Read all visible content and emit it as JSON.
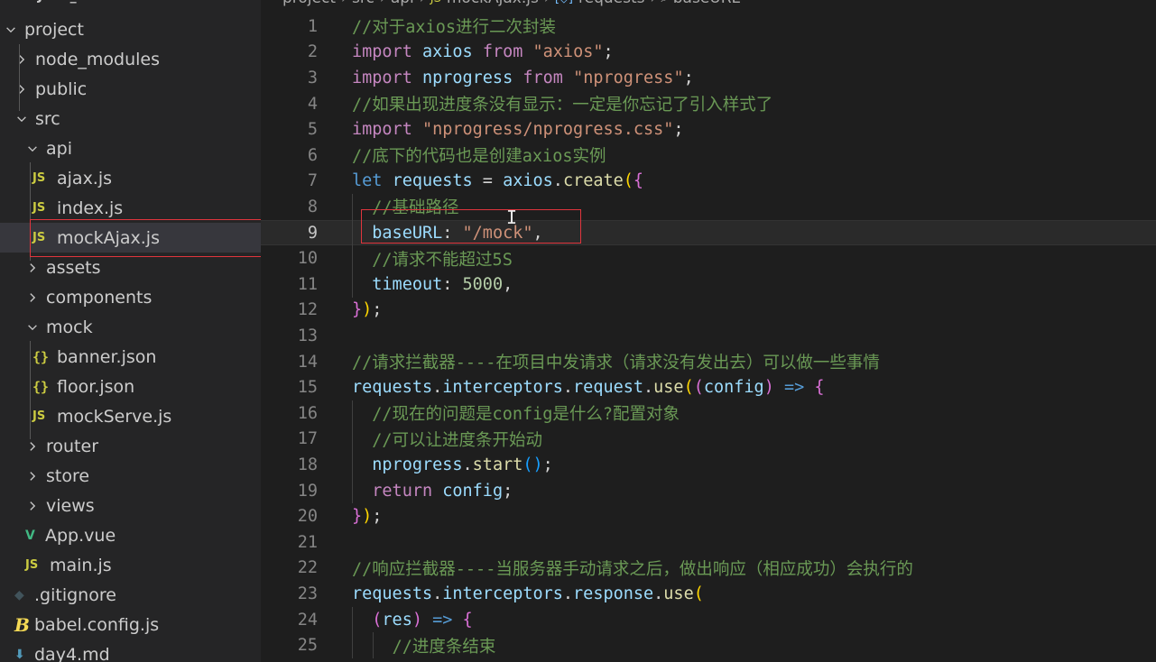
{
  "explorer": {
    "header": "PROJECT_SHP",
    "items": [
      {
        "label": "project",
        "kind": "folder",
        "open": true,
        "depth": 0,
        "icon": "chevron-down-icon"
      },
      {
        "label": "node_modules",
        "kind": "folder",
        "open": false,
        "depth": 1,
        "icon": "chevron-right-icon"
      },
      {
        "label": "public",
        "kind": "folder",
        "open": false,
        "depth": 1,
        "icon": "chevron-right-icon"
      },
      {
        "label": "src",
        "kind": "folder",
        "open": true,
        "depth": 1,
        "icon": "chevron-down-icon"
      },
      {
        "label": "api",
        "kind": "folder",
        "open": true,
        "depth": 2,
        "icon": "chevron-down-icon"
      },
      {
        "label": "ajax.js",
        "kind": "js",
        "depth": 3,
        "icon": "js-file-icon",
        "badge": "JS"
      },
      {
        "label": "index.js",
        "kind": "js",
        "depth": 3,
        "icon": "js-file-icon",
        "badge": "JS"
      },
      {
        "label": "mockAjax.js",
        "kind": "js",
        "depth": 3,
        "icon": "js-file-icon",
        "badge": "JS",
        "selected": true
      },
      {
        "label": "assets",
        "kind": "folder",
        "open": false,
        "depth": 2,
        "icon": "chevron-right-icon"
      },
      {
        "label": "components",
        "kind": "folder",
        "open": false,
        "depth": 2,
        "icon": "chevron-right-icon"
      },
      {
        "label": "mock",
        "kind": "folder",
        "open": true,
        "depth": 2,
        "icon": "chevron-down-icon"
      },
      {
        "label": "banner.json",
        "kind": "json",
        "depth": 3,
        "icon": "json-file-icon",
        "badge": "{}"
      },
      {
        "label": "floor.json",
        "kind": "json",
        "depth": 3,
        "icon": "json-file-icon",
        "badge": "{}"
      },
      {
        "label": "mockServe.js",
        "kind": "js",
        "depth": 3,
        "icon": "js-file-icon",
        "badge": "JS"
      },
      {
        "label": "router",
        "kind": "folder",
        "open": false,
        "depth": 2,
        "icon": "chevron-right-icon"
      },
      {
        "label": "store",
        "kind": "folder",
        "open": false,
        "depth": 2,
        "icon": "chevron-right-icon"
      },
      {
        "label": "views",
        "kind": "folder",
        "open": false,
        "depth": 2,
        "icon": "chevron-right-icon"
      },
      {
        "label": "App.vue",
        "kind": "vue",
        "depth": 2,
        "icon": "vue-file-icon",
        "badge": "V"
      },
      {
        "label": "main.js",
        "kind": "js",
        "depth": 2,
        "icon": "js-file-icon",
        "badge": "JS"
      },
      {
        "label": ".gitignore",
        "kind": "git",
        "depth": 1,
        "icon": "git-file-icon",
        "badge": "◆"
      },
      {
        "label": "babel.config.js",
        "kind": "babel",
        "depth": 1,
        "icon": "babel-file-icon",
        "badge": "B"
      },
      {
        "label": "day4.md",
        "kind": "md",
        "depth": 1,
        "icon": "markdown-file-icon",
        "badge": "⬇"
      }
    ]
  },
  "breadcrumb": {
    "segments": [
      "project",
      "src",
      "api",
      "mockAjax.js",
      "requests",
      "baseURL"
    ],
    "segment_icons": [
      "",
      "",
      "",
      "js-file-icon",
      "variable-icon",
      "property-icon"
    ]
  },
  "editor": {
    "current_line": 9,
    "lines": [
      {
        "n": "1",
        "tokens": [
          [
            "c",
            "//对于axios进行二次封装"
          ]
        ]
      },
      {
        "n": "2",
        "tokens": [
          [
            "kw2",
            "import"
          ],
          [
            "p",
            " "
          ],
          [
            "id",
            "axios"
          ],
          [
            "p",
            " "
          ],
          [
            "kw2",
            "from"
          ],
          [
            "p",
            " "
          ],
          [
            "s",
            "\"axios\""
          ],
          [
            "p",
            ";"
          ]
        ]
      },
      {
        "n": "3",
        "tokens": [
          [
            "kw2",
            "import"
          ],
          [
            "p",
            " "
          ],
          [
            "id",
            "nprogress"
          ],
          [
            "p",
            " "
          ],
          [
            "kw2",
            "from"
          ],
          [
            "p",
            " "
          ],
          [
            "s",
            "\"nprogress\""
          ],
          [
            "p",
            ";"
          ]
        ]
      },
      {
        "n": "4",
        "tokens": [
          [
            "c",
            "//如果出现进度条没有显示：一定是你忘记了引入样式了"
          ]
        ]
      },
      {
        "n": "5",
        "tokens": [
          [
            "kw2",
            "import"
          ],
          [
            "p",
            " "
          ],
          [
            "s",
            "\"nprogress/nprogress.css\""
          ],
          [
            "p",
            ";"
          ]
        ]
      },
      {
        "n": "6",
        "tokens": [
          [
            "c",
            "//底下的代码也是创建axios实例"
          ]
        ]
      },
      {
        "n": "7",
        "tokens": [
          [
            "kw",
            "let"
          ],
          [
            "p",
            " "
          ],
          [
            "id",
            "requests"
          ],
          [
            "p",
            " = "
          ],
          [
            "id",
            "axios"
          ],
          [
            "p",
            "."
          ],
          [
            "fn",
            "create"
          ],
          [
            "b1",
            "("
          ],
          [
            "b2",
            "{"
          ]
        ]
      },
      {
        "n": "8",
        "tokens": [
          [
            "p",
            "  "
          ],
          [
            "c",
            "//基础路径"
          ]
        ]
      },
      {
        "n": "9",
        "tokens": [
          [
            "p",
            "  "
          ],
          [
            "id",
            "baseURL"
          ],
          [
            "p",
            ": "
          ],
          [
            "s",
            "\"/mock\""
          ],
          [
            "p",
            ","
          ]
        ]
      },
      {
        "n": "10",
        "tokens": [
          [
            "p",
            "  "
          ],
          [
            "c",
            "//请求不能超过5S"
          ]
        ]
      },
      {
        "n": "11",
        "tokens": [
          [
            "p",
            "  "
          ],
          [
            "id",
            "timeout"
          ],
          [
            "p",
            ": "
          ],
          [
            "num",
            "5000"
          ],
          [
            "p",
            ","
          ]
        ]
      },
      {
        "n": "12",
        "tokens": [
          [
            "b2",
            "}"
          ],
          [
            "b1",
            ")"
          ],
          [
            "p",
            ";"
          ]
        ]
      },
      {
        "n": "13",
        "tokens": []
      },
      {
        "n": "14",
        "tokens": [
          [
            "c",
            "//请求拦截器----在项目中发请求（请求没有发出去）可以做一些事情"
          ]
        ]
      },
      {
        "n": "15",
        "tokens": [
          [
            "id",
            "requests"
          ],
          [
            "p",
            "."
          ],
          [
            "id",
            "interceptors"
          ],
          [
            "p",
            "."
          ],
          [
            "id",
            "request"
          ],
          [
            "p",
            "."
          ],
          [
            "fn",
            "use"
          ],
          [
            "b1",
            "("
          ],
          [
            "b2",
            "("
          ],
          [
            "id",
            "config"
          ],
          [
            "b2",
            ")"
          ],
          [
            "p",
            " "
          ],
          [
            "kw",
            "=>"
          ],
          [
            "p",
            " "
          ],
          [
            "b2",
            "{"
          ]
        ]
      },
      {
        "n": "16",
        "tokens": [
          [
            "p",
            "  "
          ],
          [
            "c",
            "//现在的问题是config是什么?配置对象"
          ]
        ]
      },
      {
        "n": "17",
        "tokens": [
          [
            "p",
            "  "
          ],
          [
            "c",
            "//可以让进度条开始动"
          ]
        ]
      },
      {
        "n": "18",
        "tokens": [
          [
            "p",
            "  "
          ],
          [
            "id",
            "nprogress"
          ],
          [
            "p",
            "."
          ],
          [
            "fn",
            "start"
          ],
          [
            "b3",
            "()"
          ],
          [
            "p",
            ";"
          ]
        ]
      },
      {
        "n": "19",
        "tokens": [
          [
            "p",
            "  "
          ],
          [
            "kw2",
            "return"
          ],
          [
            "p",
            " "
          ],
          [
            "id",
            "config"
          ],
          [
            "p",
            ";"
          ]
        ]
      },
      {
        "n": "20",
        "tokens": [
          [
            "b2",
            "}"
          ],
          [
            "b1",
            ")"
          ],
          [
            "p",
            ";"
          ]
        ]
      },
      {
        "n": "21",
        "tokens": []
      },
      {
        "n": "22",
        "tokens": [
          [
            "c",
            "//响应拦截器----当服务器手动请求之后，做出响应（相应成功）会执行的"
          ]
        ]
      },
      {
        "n": "23",
        "tokens": [
          [
            "id",
            "requests"
          ],
          [
            "p",
            "."
          ],
          [
            "id",
            "interceptors"
          ],
          [
            "p",
            "."
          ],
          [
            "id",
            "response"
          ],
          [
            "p",
            "."
          ],
          [
            "fn",
            "use"
          ],
          [
            "b1",
            "("
          ]
        ]
      },
      {
        "n": "24",
        "tokens": [
          [
            "p",
            "  "
          ],
          [
            "b2",
            "("
          ],
          [
            "id",
            "res"
          ],
          [
            "b2",
            ")"
          ],
          [
            "p",
            " "
          ],
          [
            "kw",
            "=>"
          ],
          [
            "p",
            " "
          ],
          [
            "b2",
            "{"
          ]
        ]
      },
      {
        "n": "25",
        "tokens": [
          [
            "p",
            "    "
          ],
          [
            "c",
            "//进度条结束"
          ]
        ]
      }
    ]
  },
  "colors": {
    "highlight_box": "#e0353d",
    "sidebar_bg": "#252526",
    "editor_bg": "#1e1e1e"
  }
}
